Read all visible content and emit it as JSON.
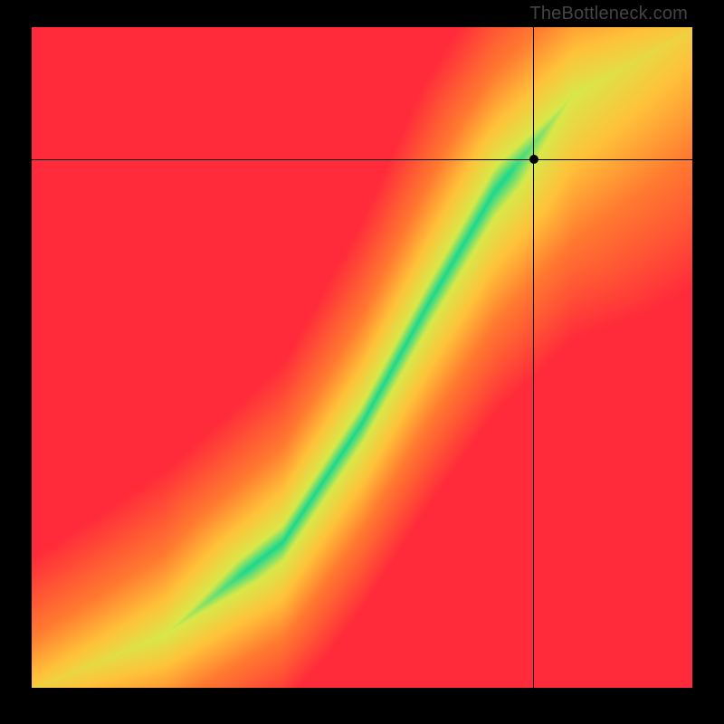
{
  "watermark": "TheBottleneck.com",
  "chart_data": {
    "type": "heatmap",
    "title": "",
    "xlabel": "",
    "ylabel": "",
    "x_range": [
      0,
      1
    ],
    "y_range": [
      0,
      1
    ],
    "crosshair": {
      "x": 0.76,
      "y": 0.8
    },
    "marker": {
      "x": 0.76,
      "y": 0.8
    },
    "ridge_description": "Diagonal green optimum band from bottom-left to top-right with S-curve shape; red-orange gradient away from the band on both sides. y-axis inverted (origin at bottom-left).",
    "ridge_control_points": [
      {
        "x": 0.0,
        "y": 0.0
      },
      {
        "x": 0.2,
        "y": 0.08
      },
      {
        "x": 0.38,
        "y": 0.22
      },
      {
        "x": 0.5,
        "y": 0.4
      },
      {
        "x": 0.6,
        "y": 0.58
      },
      {
        "x": 0.7,
        "y": 0.75
      },
      {
        "x": 0.82,
        "y": 0.9
      },
      {
        "x": 1.0,
        "y": 1.0
      }
    ],
    "ridge_half_width_fraction": 0.045,
    "colors": {
      "peak": "#1ad88f",
      "near": "#d8e84a",
      "mid": "#ffc23a",
      "far": "#ff7a30",
      "edge": "#ff2a3a"
    }
  }
}
